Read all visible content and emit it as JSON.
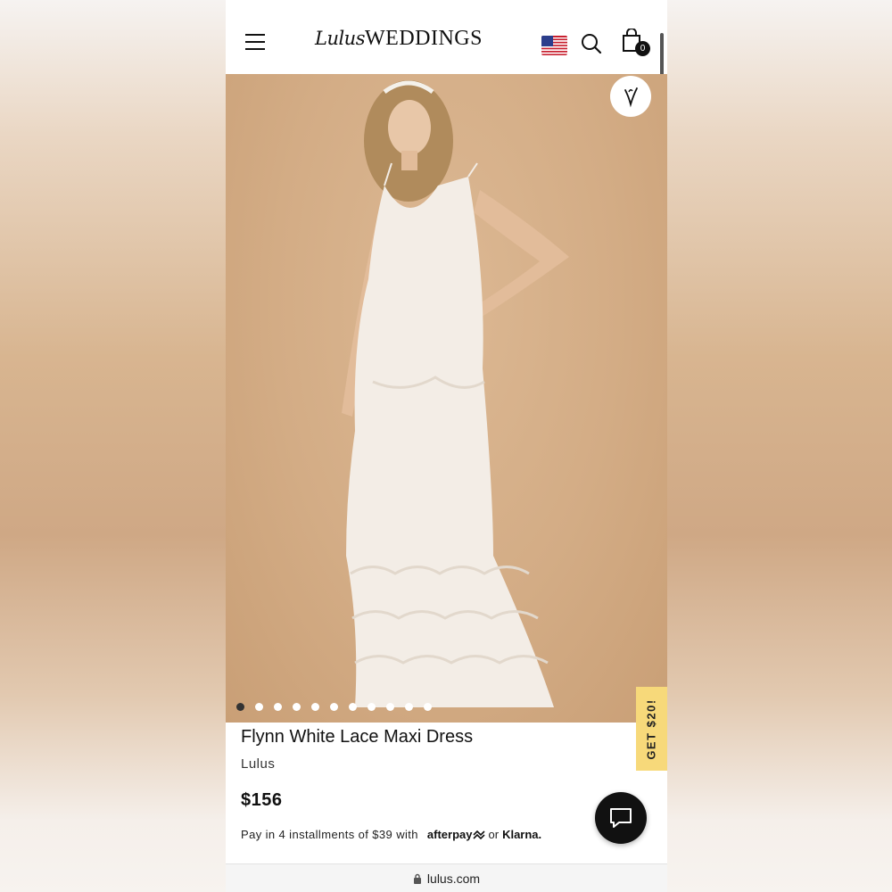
{
  "header": {
    "logo_script": "Lulus",
    "logo_main": "WEDDINGS",
    "cart_count": "0",
    "menu_icon": "hamburger-icon",
    "search_icon": "search-icon",
    "cart_icon": "shopping-bag-icon",
    "flag_icon": "us-flag-icon"
  },
  "product": {
    "title": "Flynn White Lace Maxi Dress",
    "brand": "Lulus",
    "price": "$156",
    "image_count": 11,
    "active_image": 1
  },
  "payment": {
    "text": "Pay in 4 installments of $39 with",
    "afterpay": "afterpay",
    "or": "or",
    "klarna": "Klarna."
  },
  "promo": {
    "label": "GET $20!"
  },
  "browser": {
    "url": "lulus.com"
  },
  "colors": {
    "promo_bg": "#f7d97a",
    "background_photo": "#d3ac85",
    "chat_button": "#111111"
  }
}
